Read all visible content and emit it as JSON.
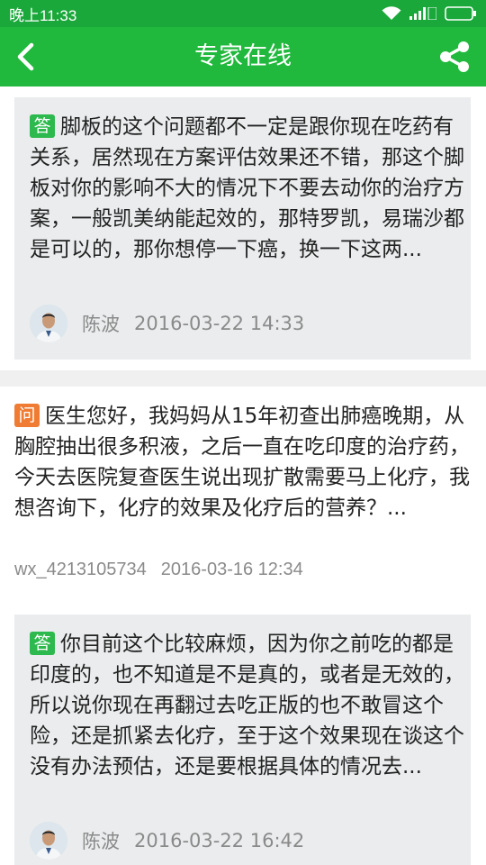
{
  "status_bar": {
    "time": "晚上11:33",
    "icons": [
      "wifi-icon",
      "signal-icon",
      "battery-icon"
    ]
  },
  "header": {
    "title": "专家在线",
    "back_icon": "back-arrow-icon",
    "share_icon": "share-icon"
  },
  "posts": [
    {
      "answers": [
        {
          "tag": "答",
          "text": "脚板的这个问题都不一定是跟你现在吃药有关系，居然现在方案评估效果还不错，那这个脚板对你的影响不大的情况下不要去动你的治疗方案，一般凯美纳能起效的，那特罗凯，易瑞沙都是可以的，那你想停一下癌，换一下这两...",
          "author": "陈波",
          "time": "2016-03-22 14:33"
        }
      ]
    },
    {
      "question": {
        "tag": "问",
        "text": "医生您好，我妈妈从15年初查出肺癌晚期，从胸腔抽出很多积液，之后一直在吃印度的治疗药，今天去医院复查医生说出现扩散需要马上化疗，我想咨询下，化疗的效果及化疗后的营养？...",
        "user": "wx_4213105734",
        "time": "2016-03-16 12:34"
      },
      "answers": [
        {
          "tag": "答",
          "text": "你目前这个比较麻烦，因为你之前吃的都是印度的，也不知道是不是真的，或者是无效的，所以说你现在再翻过去吃正版的也不敢冒这个险，还是抓紧去化疗，至于这个效果现在谈这个没有办法预估，还是要根据具体的情况去...",
          "author": "陈波",
          "time": "2016-03-22 16:42"
        }
      ]
    }
  ],
  "colors": {
    "status_bar": "#1aa83a",
    "app_bar": "#20b93d",
    "answer_tag": "#2db94d",
    "question_tag": "#f07b32",
    "answer_bg": "#eaeced",
    "meta_text": "#8a8a8a"
  }
}
